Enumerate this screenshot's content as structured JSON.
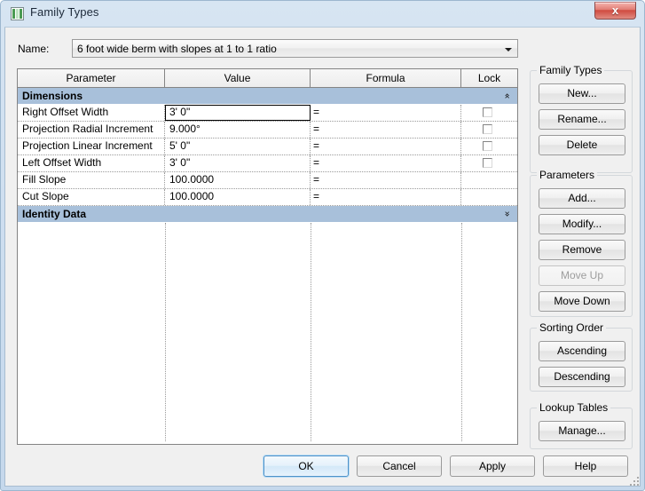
{
  "window": {
    "title": "Family Types",
    "icon": "family-types-icon",
    "close_label": "x",
    "accent_blue": "#a8c0da",
    "frame_color": "#cfdff0",
    "close_color": "#cf493e"
  },
  "name_row": {
    "label": "Name:",
    "value": "6 foot wide berm with slopes at 1 to 1 ratio",
    "placeholder": "",
    "dropdown_icon": "chevron-down-icon"
  },
  "grid": {
    "columns": [
      "Parameter",
      "Value",
      "Formula",
      "Lock"
    ],
    "groups": [
      {
        "name": "Dimensions",
        "expanded": true,
        "chevron": "«",
        "rows": [
          {
            "parameter": "Right Offset Width",
            "value": "3'  0\"",
            "formula": "=",
            "lock": true,
            "focused": true
          },
          {
            "parameter": "Projection Radial Increment",
            "value": "9.000°",
            "formula": "=",
            "lock": true,
            "focused": false
          },
          {
            "parameter": "Projection Linear Increment",
            "value": "5'  0\"",
            "formula": "=",
            "lock": true,
            "focused": false
          },
          {
            "parameter": "Left Offset Width",
            "value": "3'  0\"",
            "formula": "=",
            "lock": true,
            "focused": false
          },
          {
            "parameter": "Fill Slope",
            "value": "100.0000",
            "formula": "=",
            "lock": false,
            "focused": false
          },
          {
            "parameter": "Cut Slope",
            "value": "100.0000",
            "formula": "=",
            "lock": false,
            "focused": false
          }
        ]
      },
      {
        "name": "Identity Data",
        "expanded": false,
        "chevron": "»",
        "rows": []
      }
    ]
  },
  "side_panel": {
    "groups": [
      {
        "legend": "Family Types",
        "buttons": [
          {
            "label": "New...",
            "name": "new-type-button",
            "enabled": true
          },
          {
            "label": "Rename...",
            "name": "rename-type-button",
            "enabled": true
          },
          {
            "label": "Delete",
            "name": "delete-type-button",
            "enabled": true
          }
        ]
      },
      {
        "legend": "Parameters",
        "buttons": [
          {
            "label": "Add...",
            "name": "add-parameter-button",
            "enabled": true
          },
          {
            "label": "Modify...",
            "name": "modify-parameter-button",
            "enabled": true
          },
          {
            "label": "Remove",
            "name": "remove-parameter-button",
            "enabled": true
          },
          {
            "label": "Move Up",
            "name": "move-up-button",
            "enabled": false
          },
          {
            "label": "Move Down",
            "name": "move-down-button",
            "enabled": true
          }
        ]
      },
      {
        "legend": "Sorting Order",
        "buttons": [
          {
            "label": "Ascending",
            "name": "sort-ascending-button",
            "enabled": true
          },
          {
            "label": "Descending",
            "name": "sort-descending-button",
            "enabled": true
          }
        ]
      },
      {
        "legend": "Lookup Tables",
        "buttons": [
          {
            "label": "Manage...",
            "name": "manage-lookup-tables-button",
            "enabled": true
          }
        ]
      }
    ]
  },
  "footer": {
    "buttons": [
      {
        "label": "OK",
        "name": "ok-button",
        "default": true
      },
      {
        "label": "Cancel",
        "name": "cancel-button",
        "default": false
      },
      {
        "label": "Apply",
        "name": "apply-button",
        "default": false
      },
      {
        "label": "Help",
        "name": "help-button",
        "default": false
      }
    ]
  }
}
